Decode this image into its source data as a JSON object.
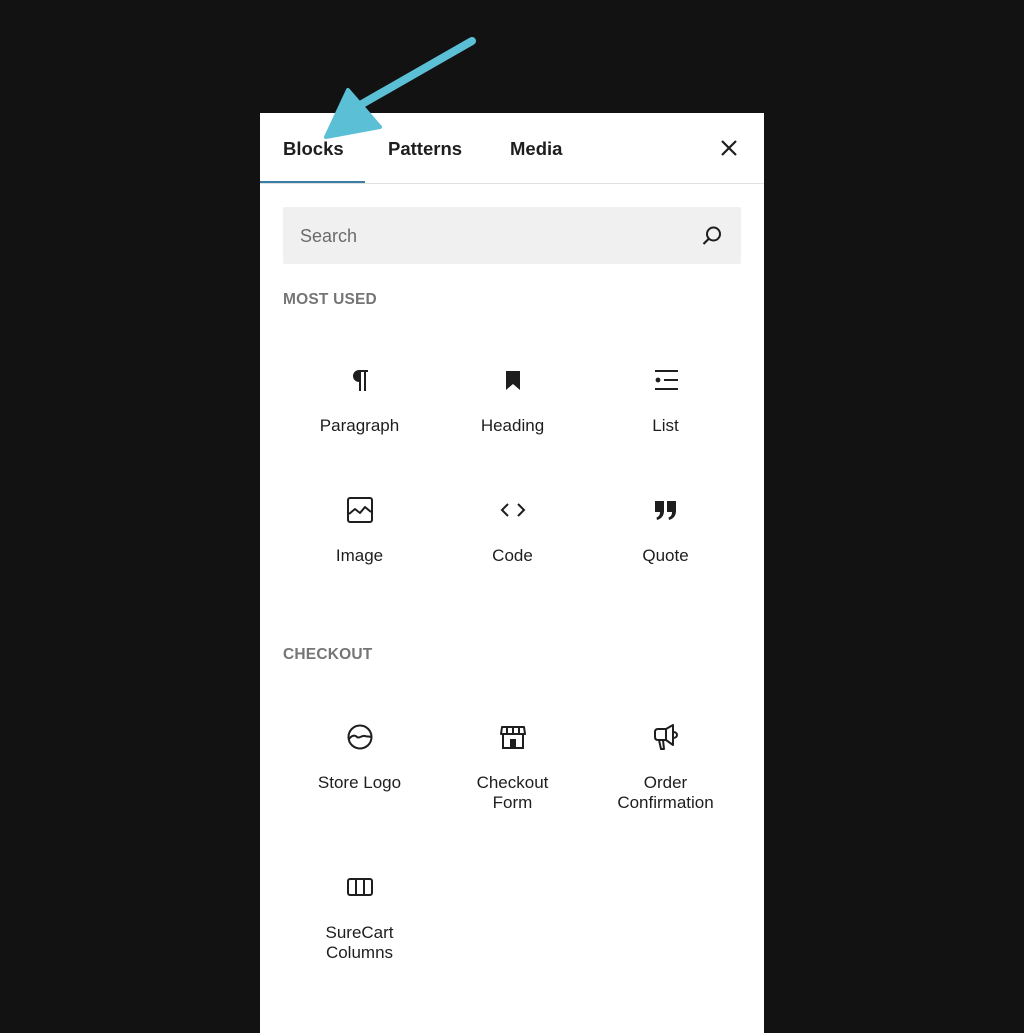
{
  "tabs": [
    {
      "label": "Blocks",
      "active": true
    },
    {
      "label": "Patterns",
      "active": false
    },
    {
      "label": "Media",
      "active": false
    }
  ],
  "close_label": "Close",
  "search": {
    "placeholder": "Search",
    "value": ""
  },
  "accent_color": "#3a7ea8",
  "annotation_arrow_color": "#5bc0d6",
  "sections": [
    {
      "title": "MOST USED",
      "items": [
        {
          "label": "Paragraph",
          "icon": "paragraph-icon"
        },
        {
          "label": "Heading",
          "icon": "bookmark-icon"
        },
        {
          "label": "List",
          "icon": "list-icon"
        },
        {
          "label": "Image",
          "icon": "image-icon"
        },
        {
          "label": "Code",
          "icon": "code-icon"
        },
        {
          "label": "Quote",
          "icon": "quote-icon"
        }
      ]
    },
    {
      "title": "CHECKOUT",
      "items": [
        {
          "label": "Store Logo",
          "icon": "store-logo-icon"
        },
        {
          "label": "Checkout Form",
          "icon": "storefront-icon"
        },
        {
          "label": "Order Confirmation",
          "icon": "megaphone-icon"
        },
        {
          "label": "SureCart Columns",
          "icon": "columns-icon"
        }
      ]
    }
  ]
}
